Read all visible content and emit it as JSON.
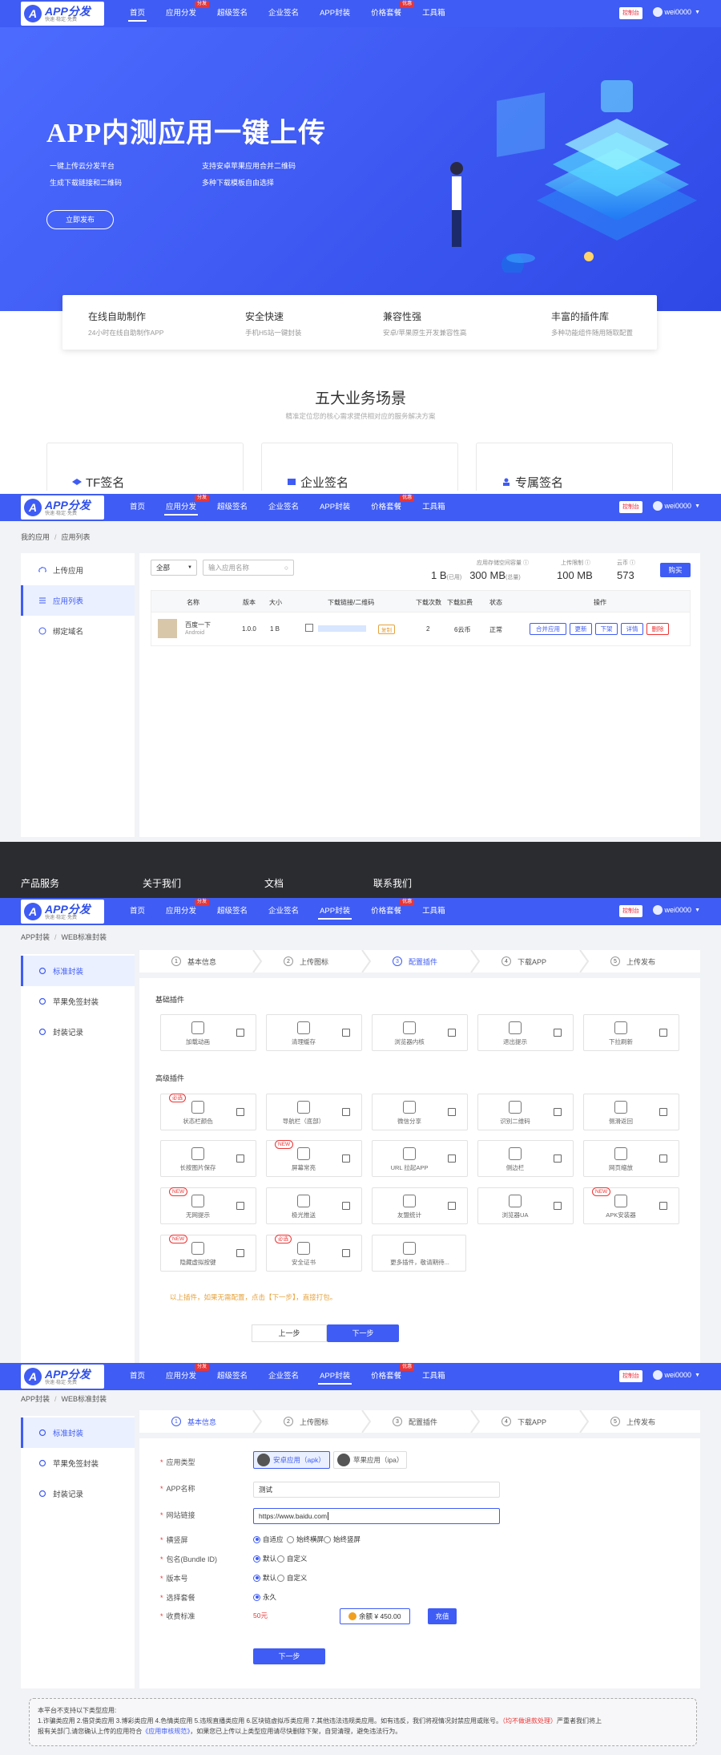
{
  "logo": {
    "name": "APP分发",
    "slogan": "快速·稳定·免费"
  },
  "nav": {
    "items": [
      {
        "label": "首页"
      },
      {
        "label": "应用分发",
        "badge": "分发"
      },
      {
        "label": "超级签名"
      },
      {
        "label": "企业签名"
      },
      {
        "label": "APP封装"
      },
      {
        "label": "价格套餐",
        "badge": "优惠"
      },
      {
        "label": "工具箱"
      }
    ],
    "control_panel": "控制台",
    "username": "wei0000"
  },
  "hero": {
    "title": "APP内测应用一键上传",
    "features": [
      "一键上传云分发平台",
      "支持安卓苹果应用合并二维码",
      "生成下载链接和二维码",
      "多种下载模板自由选择"
    ],
    "button": "立即发布"
  },
  "features": [
    {
      "title": "在线自助制作",
      "desc": "24小时在线自助制作APP"
    },
    {
      "title": "安全快速",
      "desc": "手机H5站一键封装"
    },
    {
      "title": "兼容性强",
      "desc": "安卓/苹果原生开发兼容性高"
    },
    {
      "title": "丰富的插件库",
      "desc": "多种功能组件随用随取配置"
    }
  ],
  "scenes": {
    "title": "五大业务场景",
    "subtitle": "精准定位您的核心需求提供相对应的服务解决方案",
    "cards": [
      "TF签名",
      "企业签名",
      "专属签名"
    ]
  },
  "app_list": {
    "breadcrumb": [
      "我的应用",
      "应用列表"
    ],
    "sidebar": [
      "上传应用",
      "应用列表",
      "绑定域名"
    ],
    "filter": {
      "select": "全部",
      "search_placeholder": "输入应用名称"
    },
    "stats": [
      {
        "label": "应用存储空间容量",
        "value": "1 B",
        "sub": "(已用)",
        "value2": "300 MB",
        "sub2": "(总量)"
      },
      {
        "label": "上传限制",
        "value": "100 MB"
      },
      {
        "label": "云币",
        "value": "573"
      }
    ],
    "buy_button": "购买",
    "columns": [
      "名称",
      "版本",
      "大小",
      "下载链接/二维码",
      "下载次数",
      "下载扣费",
      "状态",
      "操作"
    ],
    "rows": [
      {
        "name": "百度一下",
        "platform": "Android",
        "version": "1.0.0",
        "size": "1 B",
        "link_tag": "复制",
        "downloads": "2",
        "fee": "6云币",
        "status": "正常"
      }
    ],
    "actions": [
      "合并应用",
      "更新",
      "下架",
      "详情",
      "删除"
    ]
  },
  "footer": {
    "items": [
      "产品服务",
      "关于我们",
      "文档",
      "联系我们"
    ]
  },
  "wrap": {
    "breadcrumb": [
      "APP封装",
      "WEB标准封装"
    ],
    "sidebar": [
      "标准封装",
      "苹果免签封装",
      "封装记录"
    ],
    "steps": [
      "基本信息",
      "上传图标",
      "配置插件",
      "下载APP",
      "上传发布"
    ],
    "basic_title": "基础插件",
    "basic_plugins": [
      "加载动画",
      "清理缓存",
      "浏览器内核",
      "退出提示",
      "下拉刷新"
    ],
    "advanced_title": "高级插件",
    "advanced_plugins": [
      {
        "label": "状态栏颜色",
        "tag": "必选"
      },
      {
        "label": "导航栏（底部）"
      },
      {
        "label": "微信分享"
      },
      {
        "label": "识别二维码"
      },
      {
        "label": "侧滑返回"
      },
      {
        "label": "长按图片保存"
      },
      {
        "label": "屏幕常亮",
        "tag": "NEW"
      },
      {
        "label": "URL 拉起APP"
      },
      {
        "label": "侧边栏"
      },
      {
        "label": "网页缩放"
      },
      {
        "label": "无网提示",
        "tag": "NEW"
      },
      {
        "label": "极光推送"
      },
      {
        "label": "友盟统计"
      },
      {
        "label": "浏览器UA"
      },
      {
        "label": "APK安装器",
        "tag": "NEW"
      },
      {
        "label": "隐藏虚拟按键",
        "tag": "NEW"
      },
      {
        "label": "安全证书",
        "tag": "必选"
      },
      {
        "label": "更多插件，敬请期待..."
      }
    ],
    "note": "以上插件，如果无需配置，点击【下一步】，直接打包。",
    "prev": "上一步",
    "next": "下一步"
  },
  "form": {
    "app_type_label": "应用类型",
    "app_types": [
      "安卓应用（apk）",
      "苹果应用（ipa）"
    ],
    "app_name_label": "APP名称",
    "app_name_value": "测试",
    "url_label": "网站链接",
    "url_value": "https://www.baidu.com",
    "orient_label": "横竖屏",
    "orient_options": [
      "自适应",
      "始终横屏",
      "始终竖屏"
    ],
    "bundle_label": "包名(Bundle ID)",
    "version_label": "版本号",
    "default_options": [
      "默认",
      "自定义"
    ],
    "plan_label": "选择套餐",
    "plan_option": "永久",
    "fee_label": "收费标准",
    "fee_value": "50元",
    "balance": "余额 ¥ 450.00",
    "recharge": "充值",
    "next": "下一步",
    "notice_l1": "本平台不支持以下类型应用:",
    "notice_l2a": "1.诈骗类应用 2.借贷类应用 3.博彩类应用 4.色情类应用 5.违规直播类应用 6.区块链虚拟币类应用 7.其他违法违规类应用。如有违反，我们将视情况封禁应用或账号。",
    "notice_red": "（均不做退款处理）",
    "notice_l2b": "严重者我们将上",
    "notice_l3a": "报有关部门,请您确认上传的应用符合",
    "notice_link": "《应用审核规范》",
    "notice_l3b": "，如果您已上传以上类型应用请尽快删除下架，自觉清理，避免违法行为。"
  },
  "colors": {
    "primary": "#3f5cf4",
    "danger": "#e6363a",
    "footer": "#2b2c30"
  }
}
